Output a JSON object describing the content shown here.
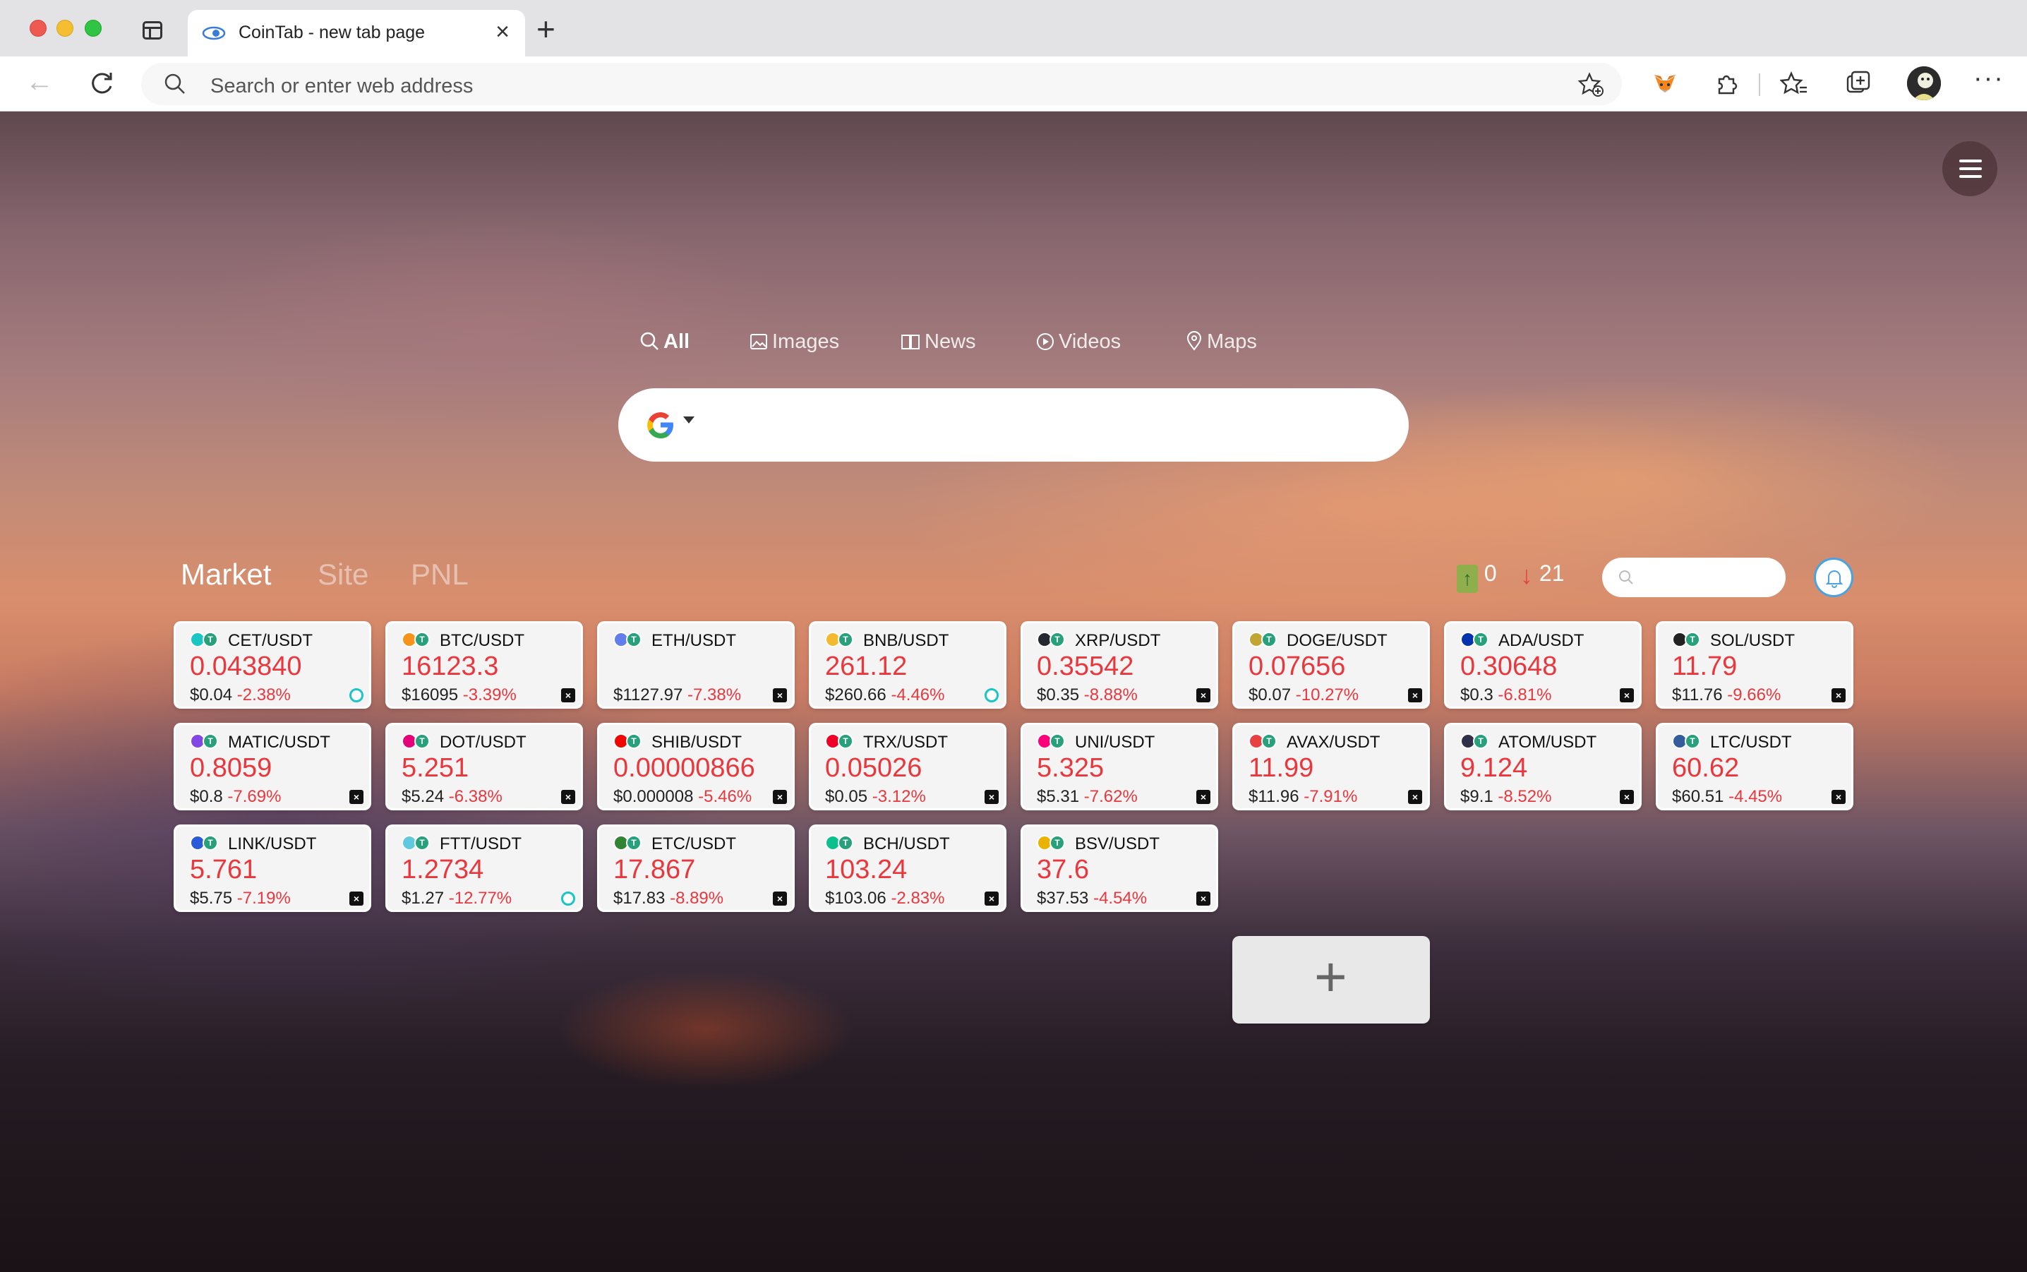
{
  "browser": {
    "tab_title": "CoinTab - new tab page",
    "address_placeholder": "Search or enter web address"
  },
  "search": {
    "tabs": [
      "All",
      "Images",
      "News",
      "Videos",
      "Maps"
    ],
    "engine": "Google"
  },
  "market": {
    "tabs": [
      "Market",
      "Site",
      "PNL"
    ],
    "up_count": "0",
    "down_count": "21"
  },
  "cards": [
    {
      "pair": "CET/USDT",
      "price": "0.043840",
      "usd": "$0.04",
      "change": "-2.38%",
      "coin_color": "#19c6c4",
      "exchange": "coinex"
    },
    {
      "pair": "BTC/USDT",
      "price": "16123.3",
      "usd": "$16095",
      "change": "-3.39%",
      "coin_color": "#f7931a",
      "exchange": "okx"
    },
    {
      "pair": "ETH/USDT",
      "price": "",
      "usd": "$1127.97",
      "change": "-7.38%",
      "coin_color": "#627eea",
      "exchange": "okx"
    },
    {
      "pair": "BNB/USDT",
      "price": "261.12",
      "usd": "$260.66",
      "change": "-4.46%",
      "coin_color": "#f3ba2f",
      "exchange": "coinex"
    },
    {
      "pair": "XRP/USDT",
      "price": "0.35542",
      "usd": "$0.35",
      "change": "-8.88%",
      "coin_color": "#23292f",
      "exchange": "okx"
    },
    {
      "pair": "DOGE/USDT",
      "price": "0.07656",
      "usd": "$0.07",
      "change": "-10.27%",
      "coin_color": "#c2a633",
      "exchange": "okx"
    },
    {
      "pair": "ADA/USDT",
      "price": "0.30648",
      "usd": "$0.3",
      "change": "-6.81%",
      "coin_color": "#0033ad",
      "exchange": "okx"
    },
    {
      "pair": "SOL/USDT",
      "price": "11.79",
      "usd": "$11.76",
      "change": "-9.66%",
      "coin_color": "#222222",
      "exchange": "okx"
    },
    {
      "pair": "MATIC/USDT",
      "price": "0.8059",
      "usd": "$0.8",
      "change": "-7.69%",
      "coin_color": "#8247e5",
      "exchange": "okx"
    },
    {
      "pair": "DOT/USDT",
      "price": "5.251",
      "usd": "$5.24",
      "change": "-6.38%",
      "coin_color": "#e6007a",
      "exchange": "okx"
    },
    {
      "pair": "SHIB/USDT",
      "price": "0.00000866",
      "usd": "$0.000008",
      "change": "-5.46%",
      "coin_color": "#f00500",
      "exchange": "okx"
    },
    {
      "pair": "TRX/USDT",
      "price": "0.05026",
      "usd": "$0.05",
      "change": "-3.12%",
      "coin_color": "#ef0027",
      "exchange": "okx"
    },
    {
      "pair": "UNI/USDT",
      "price": "5.325",
      "usd": "$5.31",
      "change": "-7.62%",
      "coin_color": "#ff007a",
      "exchange": "okx"
    },
    {
      "pair": "AVAX/USDT",
      "price": "11.99",
      "usd": "$11.96",
      "change": "-7.91%",
      "coin_color": "#e84142",
      "exchange": "okx"
    },
    {
      "pair": "ATOM/USDT",
      "price": "9.124",
      "usd": "$9.1",
      "change": "-8.52%",
      "coin_color": "#2e3148",
      "exchange": "okx"
    },
    {
      "pair": "LTC/USDT",
      "price": "60.62",
      "usd": "$60.51",
      "change": "-4.45%",
      "coin_color": "#345d9d",
      "exchange": "okx"
    },
    {
      "pair": "LINK/USDT",
      "price": "5.761",
      "usd": "$5.75",
      "change": "-7.19%",
      "coin_color": "#2a5ada",
      "exchange": "okx"
    },
    {
      "pair": "FTT/USDT",
      "price": "1.2734",
      "usd": "$1.27",
      "change": "-12.77%",
      "coin_color": "#5fcade",
      "exchange": "coinex"
    },
    {
      "pair": "ETC/USDT",
      "price": "17.867",
      "usd": "$17.83",
      "change": "-8.89%",
      "coin_color": "#328332",
      "exchange": "okx"
    },
    {
      "pair": "BCH/USDT",
      "price": "103.24",
      "usd": "$103.06",
      "change": "-2.83%",
      "coin_color": "#0ac18e",
      "exchange": "okx"
    },
    {
      "pair": "BSV/USDT",
      "price": "37.6",
      "usd": "$37.53",
      "change": "-4.54%",
      "coin_color": "#eab300",
      "exchange": "okx"
    }
  ],
  "add_card_label": "+",
  "colors": {
    "price_red": "#e8383d",
    "tether_green": "#26a17b",
    "bell_blue": "#4aa3e0"
  }
}
